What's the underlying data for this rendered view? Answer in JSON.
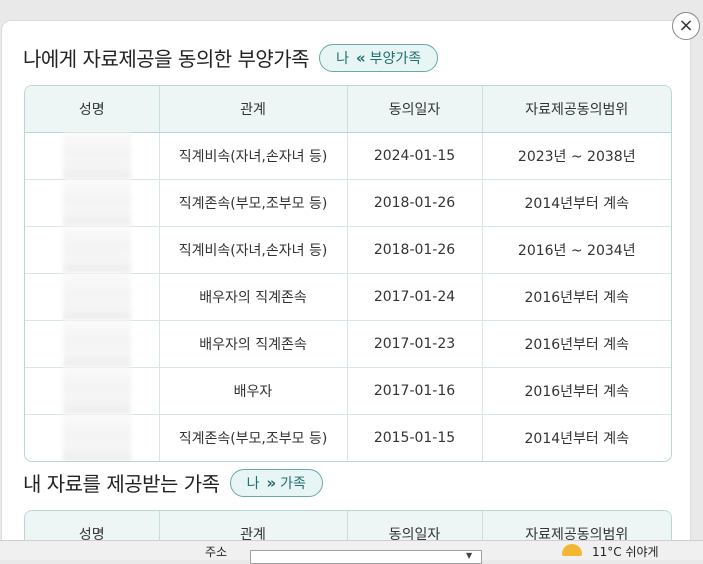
{
  "modal": {
    "close_icon": "×"
  },
  "section1": {
    "title": "나에게 자료제공을 동의한 부양가족",
    "pill": {
      "me": "나",
      "arrow": "«",
      "label": "부양가족"
    },
    "headers": [
      "성명",
      "관계",
      "동의일자",
      "자료제공동의범위"
    ],
    "rows": [
      {
        "name": "",
        "relation": "직계비속(자녀,손자녀 등)",
        "date": "2024-01-15",
        "scope": "2023년 ~ 2038년"
      },
      {
        "name": "",
        "relation": "직계존속(부모,조부모 등)",
        "date": "2018-01-26",
        "scope": "2014년부터 계속"
      },
      {
        "name": "",
        "relation": "직계비속(자녀,손자녀 등)",
        "date": "2018-01-26",
        "scope": "2016년 ~ 2034년"
      },
      {
        "name": "",
        "relation": "배우자의 직계존속",
        "date": "2017-01-24",
        "scope": "2016년부터 계속"
      },
      {
        "name": "",
        "relation": "배우자의 직계존속",
        "date": "2017-01-23",
        "scope": "2016년부터 계속"
      },
      {
        "name": "",
        "relation": "배우자",
        "date": "2017-01-16",
        "scope": "2016년부터 계속"
      },
      {
        "name": "",
        "relation": "직계존속(부모,조부모 등)",
        "date": "2015-01-15",
        "scope": "2014년부터 계속"
      }
    ]
  },
  "section2": {
    "title": "내 자료를 제공받는 가족",
    "pill": {
      "me": "나",
      "arrow": "»",
      "label": "가족"
    },
    "headers": [
      "성명",
      "관계",
      "동의일자",
      "자료제공동의범위"
    ]
  },
  "taskbar": {
    "address_label": "주소",
    "weather": "11°C 쉬야게"
  }
}
